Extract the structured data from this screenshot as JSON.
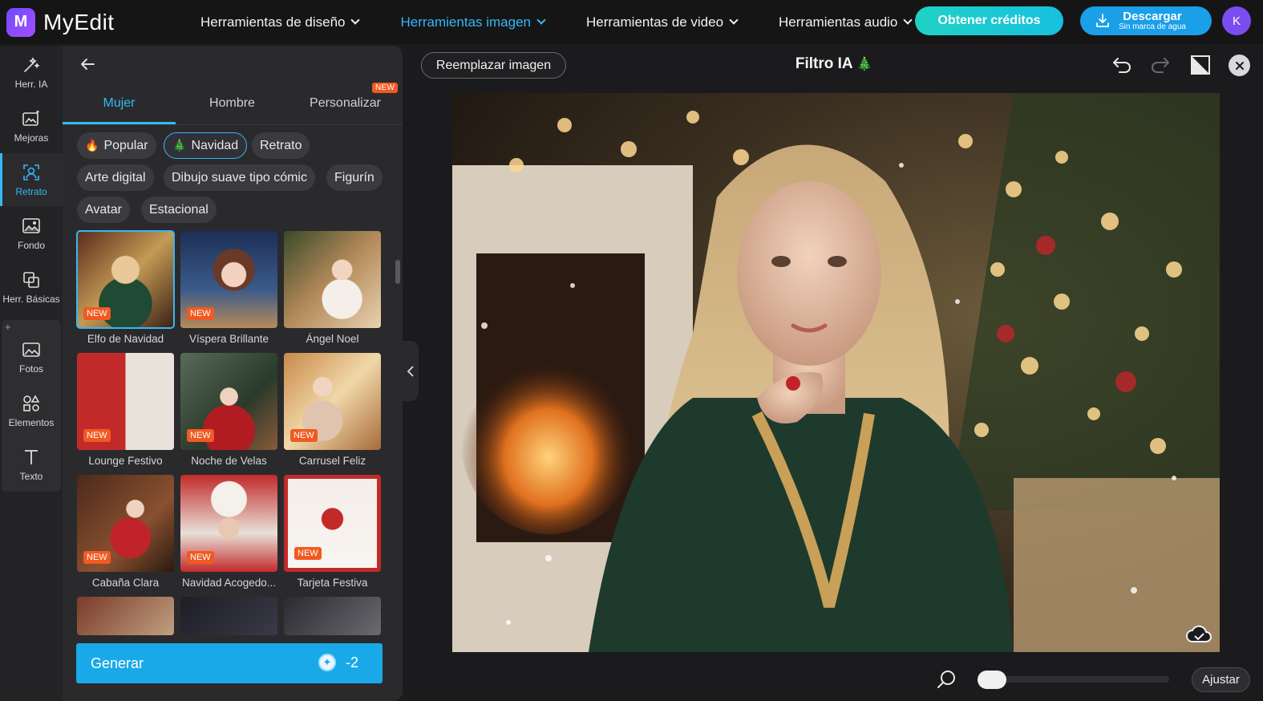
{
  "app": {
    "name": "MyEdit",
    "logo_letter": "M",
    "user_initial": "K"
  },
  "nav": [
    {
      "label": "Herramientas de diseño",
      "active": false
    },
    {
      "label": "Herramientas imagen",
      "active": true
    },
    {
      "label": "Herramientas de video",
      "active": false
    },
    {
      "label": "Herramientas audio",
      "active": false
    }
  ],
  "header": {
    "credits_label": "Obtener créditos",
    "download_label": "Descargar",
    "download_sub": "Sin marca de agua"
  },
  "rail": [
    {
      "label": "Herr. IA",
      "icon": "magic-wand-icon"
    },
    {
      "label": "Mejoras",
      "icon": "enhance-image-icon"
    },
    {
      "label": "Retrato",
      "icon": "portrait-icon",
      "active": true
    },
    {
      "label": "Fondo",
      "icon": "background-icon"
    },
    {
      "label": "Herr. Básicas",
      "icon": "crop-icon"
    },
    {
      "label": "Fotos",
      "icon": "photos-icon"
    },
    {
      "label": "Elementos",
      "icon": "elements-icon"
    },
    {
      "label": "Texto",
      "icon": "text-icon"
    }
  ],
  "rail_plus": "+",
  "panel": {
    "tabs": [
      {
        "label": "Mujer",
        "active": true
      },
      {
        "label": "Hombre"
      },
      {
        "label": "Personalizar",
        "badge": "NEW"
      }
    ],
    "chips": [
      {
        "label": "Popular",
        "emoji": "🔥"
      },
      {
        "label": "Navidad",
        "emoji": "🎄",
        "active": true
      },
      {
        "label": "Retrato"
      },
      {
        "label": "Arte digital"
      },
      {
        "label": "Dibujo suave tipo cómic"
      },
      {
        "label": "Figurín"
      },
      {
        "label": "Avatar"
      },
      {
        "label": "Estacional"
      }
    ],
    "styles": [
      {
        "label": "Elfo de Navidad",
        "badge": "NEW",
        "selected": true
      },
      {
        "label": "Víspera Brillante",
        "badge": "NEW"
      },
      {
        "label": "Ángel Noel"
      },
      {
        "label": "Lounge Festivo",
        "badge": "NEW"
      },
      {
        "label": "Noche de Velas",
        "badge": "NEW"
      },
      {
        "label": "Carrusel Feliz",
        "badge": "NEW"
      },
      {
        "label": "Cabaña Clara",
        "badge": "NEW"
      },
      {
        "label": "Navidad Acogedo...",
        "badge": "NEW"
      },
      {
        "label": "Tarjeta Festiva",
        "badge": "NEW"
      }
    ],
    "generate_label": "Generar",
    "generate_cost": "-2"
  },
  "canvas": {
    "replace_label": "Reemplazar imagen",
    "title": "Filtro IA",
    "title_emoji": "🎄",
    "fit_label": "Ajustar",
    "zoom_level": 0.0
  },
  "colors": {
    "accent": "#35b8f5",
    "badge": "#f05a22",
    "credits": "#1fd2c4",
    "download": "#1a9fe8"
  }
}
